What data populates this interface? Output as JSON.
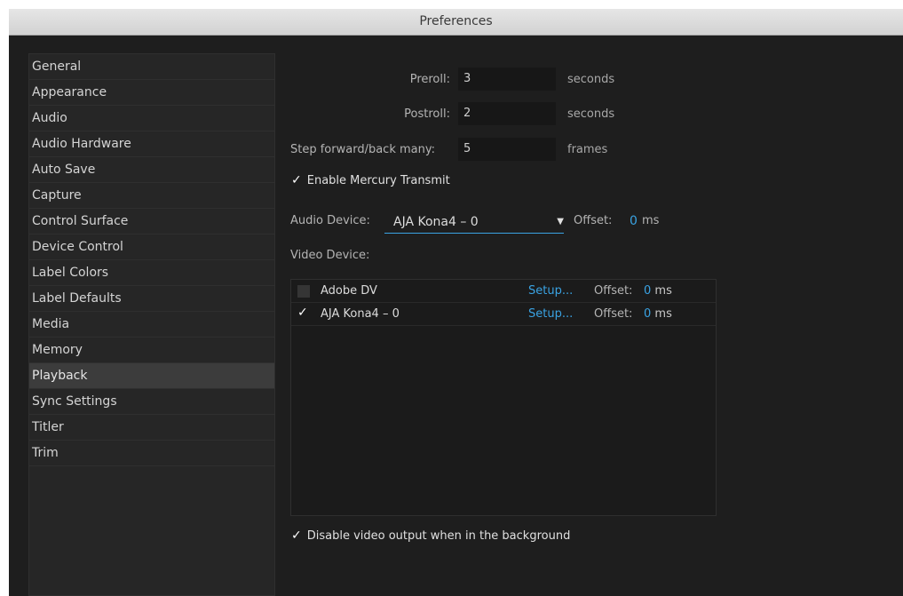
{
  "window": {
    "title": "Preferences"
  },
  "sidebar": {
    "items": [
      {
        "label": "General",
        "selected": false
      },
      {
        "label": "Appearance",
        "selected": false
      },
      {
        "label": "Audio",
        "selected": false
      },
      {
        "label": "Audio Hardware",
        "selected": false
      },
      {
        "label": "Auto Save",
        "selected": false
      },
      {
        "label": "Capture",
        "selected": false
      },
      {
        "label": "Control Surface",
        "selected": false
      },
      {
        "label": "Device Control",
        "selected": false
      },
      {
        "label": "Label Colors",
        "selected": false
      },
      {
        "label": "Label Defaults",
        "selected": false
      },
      {
        "label": "Media",
        "selected": false
      },
      {
        "label": "Memory",
        "selected": false
      },
      {
        "label": "Playback",
        "selected": true
      },
      {
        "label": "Sync Settings",
        "selected": false
      },
      {
        "label": "Titler",
        "selected": false
      },
      {
        "label": "Trim",
        "selected": false
      }
    ]
  },
  "playback": {
    "preroll": {
      "label": "Preroll:",
      "value": "3",
      "unit": "seconds"
    },
    "postroll": {
      "label": "Postroll:",
      "value": "2",
      "unit": "seconds"
    },
    "step": {
      "label": "Step forward/back many:",
      "value": "5",
      "unit": "frames"
    },
    "mercury": {
      "label": "Enable Mercury Transmit",
      "checked": true,
      "mark": "✓"
    },
    "audio_device": {
      "label": "Audio Device:",
      "value": "AJA Kona4 – 0",
      "caret": "▼",
      "offset_label": "Offset:",
      "offset_value": "0",
      "offset_unit": "ms"
    },
    "video_device": {
      "label": "Video Device:",
      "devices": [
        {
          "name": "Adobe DV",
          "checked": false,
          "mark": "",
          "setup": "Setup...",
          "offset_label": "Offset:",
          "offset_value": "0",
          "offset_unit": "ms"
        },
        {
          "name": "AJA Kona4 – 0",
          "checked": true,
          "mark": "✓",
          "setup": "Setup...",
          "offset_label": "Offset:",
          "offset_value": "0",
          "offset_unit": "ms"
        }
      ]
    },
    "disable_bg": {
      "label": "Disable video output when in the background",
      "checked": true,
      "mark": "✓"
    }
  },
  "colors": {
    "accent": "#3aa3e3",
    "panel": "#1e1e1e",
    "selected": "#3c3c3c"
  }
}
